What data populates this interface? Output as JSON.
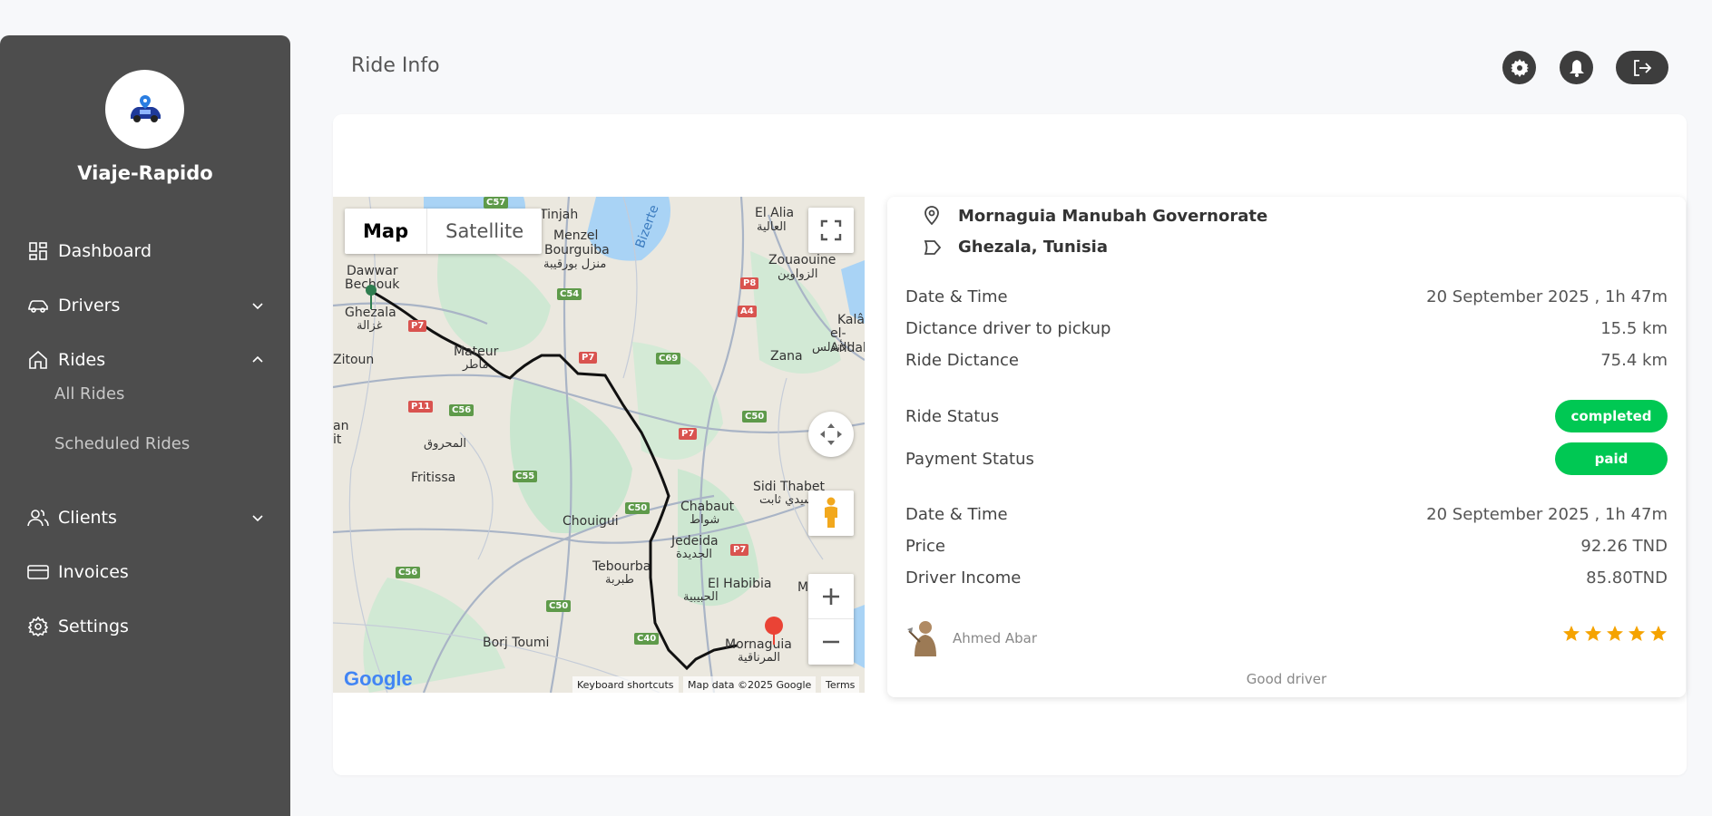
{
  "app": {
    "name": "Viaje-Rapido"
  },
  "sidebar": {
    "items": [
      {
        "label": "Dashboard",
        "icon": "dashboard-icon"
      },
      {
        "label": "Drivers",
        "icon": "car-icon",
        "expandable": true,
        "expanded": false
      },
      {
        "label": "Rides",
        "icon": "home-icon",
        "expandable": true,
        "expanded": true
      },
      {
        "label": "Clients",
        "icon": "users-icon",
        "expandable": true,
        "expanded": false
      },
      {
        "label": "Invoices",
        "icon": "card-icon"
      },
      {
        "label": "Settings",
        "icon": "gear-icon"
      }
    ],
    "rides_sub": [
      "All Rides",
      "Scheduled Rides"
    ]
  },
  "header": {
    "title": "Ride Info",
    "buttons": [
      "gear-icon",
      "bell-icon",
      "logout-icon"
    ]
  },
  "map": {
    "type_buttons": {
      "map": "Map",
      "satellite": "Satellite",
      "selected": "Map"
    },
    "labels": {
      "tinjah": "Tinjah",
      "menzel": "Menzel",
      "bourguiba": "Bourguiba",
      "menzel_ar": "منزل بورقيبة",
      "bizerte": "Bizerte",
      "el_alia": "El Alia",
      "el_alia_ar": "العالية",
      "zouaouine": "Zouaouine",
      "zouaouine_ar": "الزواوين",
      "dawwar": "Dawwar",
      "bechouk": "Bechouk",
      "ghezala": "Ghezala",
      "ghezala_ar": "غزالة",
      "zitoun": "Zitoun",
      "mateur": "Mateur",
      "mateur_ar": "ماطر",
      "zana": "Zana",
      "el_andal": "el-Andal",
      "el_andal_ar": "الأندلس",
      "kalaa": "Kalâa",
      "an": "an",
      "it": "it",
      "mahrouk": "المحروق",
      "fritissa": "Fritissa",
      "sidi_thabet": "Sidi Thabet",
      "sidi_thabet_ar": "سيدي ثابت",
      "chouigui": "Chouigui",
      "chabaut": "Chabaut",
      "chabaut_ar": "شواط",
      "jedeida": "Jedeida",
      "jedeida_ar": "الجديدة",
      "tebourba": "Tebourba",
      "tebourba_ar": "طبربة",
      "el_habibia": "El Habibia",
      "el_habibia_ar": "الحبيبية",
      "m": "M",
      "mornaguia": "Mornaguia",
      "mornaguia_ar": "المرناقية",
      "borj_toumi": "Borj Toumi"
    },
    "road_labels": [
      "C57",
      "C54",
      "P8",
      "A4",
      "P7",
      "P7",
      "C69",
      "C50",
      "P11",
      "C56",
      "P7",
      "C55",
      "C50",
      "P7",
      "C56",
      "C50",
      "C40"
    ],
    "attribution": {
      "logo": "Google",
      "shortcuts": "Keyboard shortcuts",
      "data": "Map data ©2025 Google",
      "terms": "Terms"
    },
    "colors": {
      "pickup_marker": "#2e7d4f",
      "dropoff_marker": "#ea4335",
      "route": "#111111"
    }
  },
  "ride": {
    "pickup": "Mornaguia Manubah Governorate",
    "dropoff": "Ghezala, Tunisia",
    "rows1": [
      {
        "label": "Date & Time",
        "value": "20 September 2025 , 1h 47m"
      },
      {
        "label": "Dictance driver to pickup",
        "value": "15.5 km"
      },
      {
        "label": "Ride Dictance",
        "value": "75.4 km"
      }
    ],
    "status": [
      {
        "label": "Ride Status",
        "value": "completed"
      },
      {
        "label": "Payment Status",
        "value": "paid"
      }
    ],
    "rows2": [
      {
        "label": "Date & Time",
        "value": "20 September 2025 , 1h 47m"
      },
      {
        "label": "Price",
        "value": "92.26 TND"
      },
      {
        "label": "Driver Income",
        "value": "85.80TND"
      }
    ],
    "driver": {
      "name": "Ahmed Abar",
      "rating": 5
    },
    "review": "Good driver",
    "colors": {
      "badge": "#00c853",
      "star": "#f5a300"
    }
  }
}
